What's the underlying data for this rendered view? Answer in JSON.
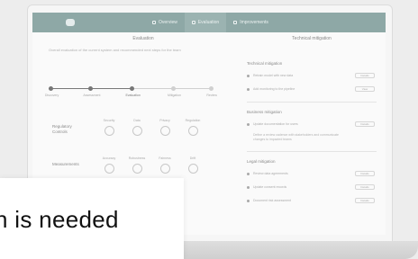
{
  "banner": {
    "text": "n is needed"
  },
  "app": {
    "nav_tabs": [
      {
        "label": "Overview"
      },
      {
        "label": "Evaluation"
      },
      {
        "label": "Improvements"
      }
    ]
  },
  "left_panel": {
    "title": "Evaluation",
    "intro": "Overall evaluation of the current system and recommended next steps for the team",
    "steps": [
      "Discovery",
      "Assessment",
      "Evaluation",
      "Mitigation",
      "Review"
    ],
    "rows": [
      {
        "label": "Regulatory Controls",
        "gauges": [
          "Security",
          "Data",
          "Privacy",
          "Regulation"
        ]
      },
      {
        "label": "Measurements",
        "gauges": [
          "Accuracy",
          "Robustness",
          "Fairness",
          "Drift"
        ]
      }
    ]
  },
  "right_panel": {
    "title": "Technical mitigation",
    "sections": [
      {
        "head": "Technical mitigation",
        "items": [
          {
            "text": "Retrain model with new data",
            "pill": "Details"
          },
          {
            "text": "Add monitoring to the pipeline",
            "pill": "View"
          }
        ]
      },
      {
        "head": "Business mitigation",
        "items": [
          {
            "text": "Update documentation for users",
            "pill": "Details"
          }
        ],
        "note": "Define a review cadence with stakeholders and communicate changes to impacted teams"
      },
      {
        "head": "Legal mitigation",
        "items": [
          {
            "text": "Review data agreements",
            "pill": "Details"
          },
          {
            "text": "Update consent records",
            "pill": "Details"
          },
          {
            "text": "Document risk assessment",
            "pill": "Details"
          }
        ]
      }
    ]
  },
  "colors": {
    "header": "#8ea8a6",
    "gauge_ring": "#c8c8c8"
  }
}
